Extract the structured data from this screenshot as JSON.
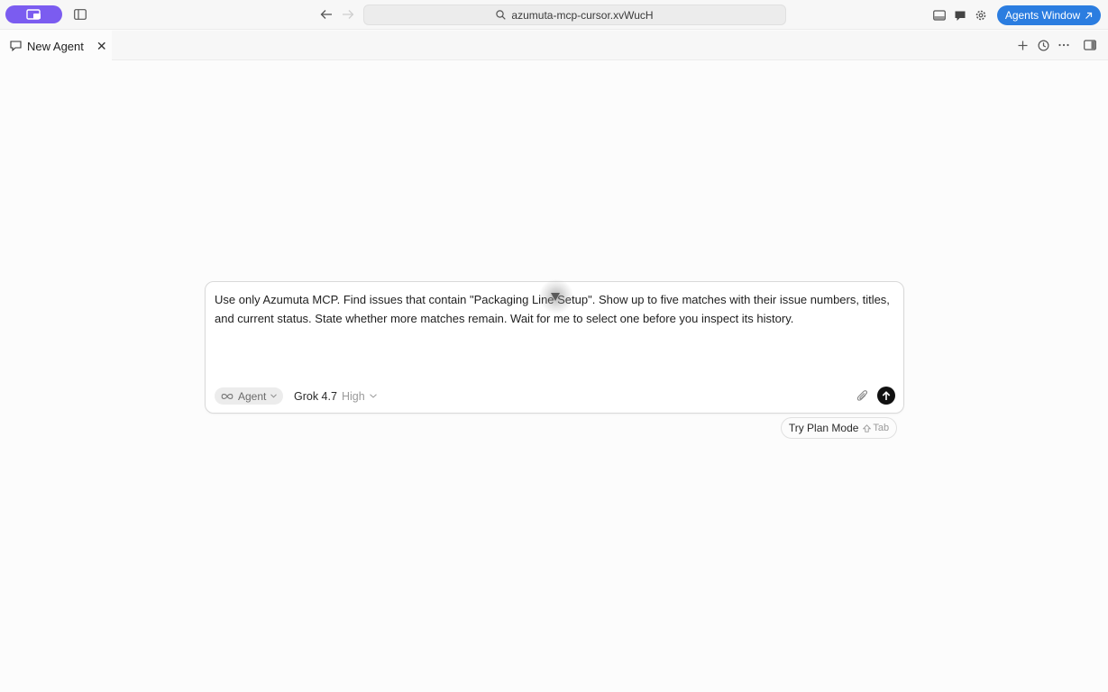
{
  "titlebar": {
    "url": "azumuta-mcp-cursor.xvWucH",
    "agents_window_label": "Agents Window",
    "accent": "#2b7de0",
    "pill_color": "#7b5cf0"
  },
  "tabs": [
    {
      "label": "New Agent"
    }
  ],
  "composer": {
    "prompt": "Use only Azumuta MCP. Find issues that contain \"Packaging Line Setup\". Show up to five matches with their issue numbers, titles, and current status. State whether more matches remain. Wait for me to select one before you inspect its history.",
    "mode_label": "Agent",
    "model_name": "Grok 4.7",
    "model_effort": "High"
  },
  "plan_mode": {
    "label": "Try Plan Mode",
    "shortcut": "Tab"
  }
}
